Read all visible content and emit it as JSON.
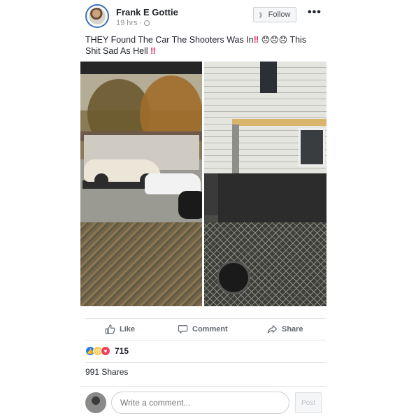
{
  "post": {
    "author": "Frank E Gottie",
    "time": "19 hrs",
    "separator": "·",
    "follow_label": "Follow",
    "more_label": "•••",
    "caption_part1": "THEY Found The Car The Shooters Was In",
    "caption_bang": "‼",
    "caption_emojis": "😞😞😞",
    "caption_part2": "This Shit Sad As Hell",
    "caption_bang2": "‼",
    "images": [
      "tow-truck-street-photo",
      "tow-truck-fence-photo"
    ]
  },
  "actions": {
    "like": "Like",
    "comment": "Comment",
    "share": "Share"
  },
  "reactions": {
    "count": "715",
    "types": [
      "like",
      "sad",
      "love"
    ]
  },
  "shares": "991 Shares",
  "comment_box": {
    "placeholder": "Write a comment...",
    "post_label": "Post"
  },
  "icons": {
    "like": "thumbs-up-icon",
    "comment": "speech-bubble-icon",
    "share": "share-arrow-icon",
    "follow": "rss-icon",
    "more": "more-icon",
    "privacy": "globe-icon"
  },
  "colors": {
    "link_blue": "#3a6fc0",
    "like_blue": "#1877f2",
    "love_red": "#f33e58",
    "sad_yellow": "#f7c948",
    "text_gray": "#606770"
  }
}
